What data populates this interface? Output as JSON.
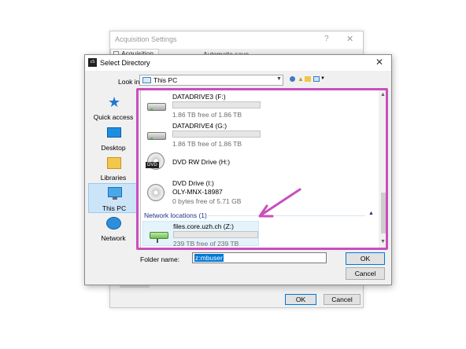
{
  "background_dialog": {
    "title": "Acquisition Settings",
    "help": "?",
    "close": "✕",
    "tab_label": "Acquisition",
    "option_label": "Automatic save",
    "ok": "OK",
    "cancel": "Cancel"
  },
  "dialog": {
    "app_icon": "cS",
    "title": "Select Directory",
    "close": "✕",
    "look_in_label": "Look in:",
    "look_in_value": "This PC",
    "places": [
      {
        "label": "Quick access",
        "icon": "star-icon"
      },
      {
        "label": "Desktop",
        "icon": "desktop-icon"
      },
      {
        "label": "Libraries",
        "icon": "libraries-icon"
      },
      {
        "label": "This PC",
        "icon": "computer-icon",
        "selected": true
      },
      {
        "label": "Network",
        "icon": "network-icon"
      }
    ],
    "drives": [
      {
        "name": "DATADRIVE3 (F:)",
        "free": "1.86 TB free of 1.86 TB",
        "used_fraction": 0.0,
        "icon": "hard-drive-icon"
      },
      {
        "name": "DATADRIVE4 (G:)",
        "free": "1.86 TB free of 1.86 TB",
        "used_fraction": 0.0,
        "icon": "hard-drive-icon"
      },
      {
        "name": "DVD RW Drive (H:)",
        "icon": "dvd-drive-icon",
        "icon_tag": "DVD"
      },
      {
        "name": "DVD Drive (I:)",
        "label": "OLY-MNX-18987",
        "free": "0 bytes free of 5.71 GB",
        "icon": "dvd-drive-icon"
      }
    ],
    "network_group": "Network locations (1)",
    "network_drive": {
      "name": "files.core.uzh.ch (Z:)",
      "free": "239 TB free of 239 TB",
      "used_fraction": 0.0,
      "icon": "network-drive-icon"
    },
    "folder_name_label": "Folder name:",
    "folder_name_value": "z:mbuser",
    "ok": "OK",
    "cancel": "Cancel"
  },
  "colors": {
    "highlight": "#c94fbd",
    "arrow": "#c94fbd",
    "accent": "#0078d7",
    "selection": "#cce4f7",
    "group_text": "#1e3287"
  }
}
